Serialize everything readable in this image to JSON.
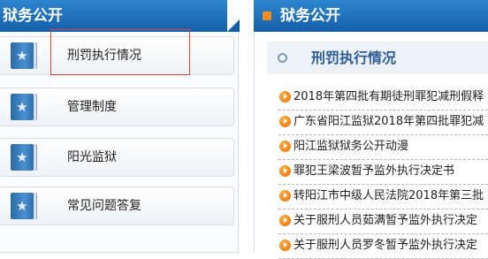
{
  "left": {
    "header": "狱务公开",
    "menu": [
      {
        "label": "刑罚执行情况"
      },
      {
        "label": "管理制度"
      },
      {
        "label": "阳光监狱"
      },
      {
        "label": "常见问题答复"
      }
    ]
  },
  "right": {
    "header": "狱务公开",
    "section_title": "刑罚执行情况",
    "news": [
      {
        "text": "2018年第四批有期徒刑罪犯减刑假释"
      },
      {
        "text": "广东省阳江监狱2018年第四批罪犯减"
      },
      {
        "text": "阳江监狱狱务公开动漫"
      },
      {
        "text": "罪犯王梁波暂予监外执行决定书"
      },
      {
        "text": "转阳江市中级人民法院2018年第三批"
      },
      {
        "text": "关于服刑人员茹满暂予监外执行决定"
      },
      {
        "text": "关于服刑人员罗冬暂予监外执行决定"
      }
    ]
  },
  "colors": {
    "header_blue": "#1a6fbc",
    "accent_orange": "#f07d10",
    "highlight_red": "#e2433d",
    "section_title": "#2b5d94"
  },
  "icons": {
    "menu_icon": "star-book-icon",
    "news_bullet": "orange-arrow-icon"
  }
}
